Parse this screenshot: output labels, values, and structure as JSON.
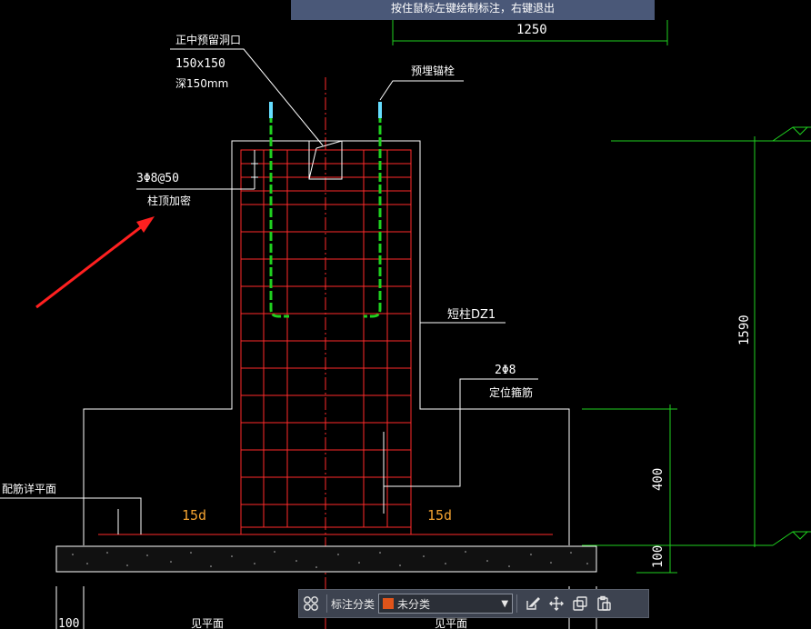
{
  "tip": {
    "text": "按住鼠标左键绘制标注，右键退出"
  },
  "drawing": {
    "dim_top": "1250",
    "dim_right_total": "1590",
    "dim_right_mid": "400",
    "dim_right_low": "100",
    "dim_bottom_left": "100",
    "label_opening_title": "正中预留洞口",
    "label_opening_size": "150x150",
    "label_opening_depth": "深150mm",
    "label_anchor_bolt": "预埋锚栓",
    "label_stirrup_spec": "3Φ8@50",
    "label_stirrup_note": "柱顶加密",
    "label_column": "短柱DZ1",
    "label_position_bar_spec": "2Φ8",
    "label_position_bar_note": "定位箍筋",
    "label_floor": "配筋详平面",
    "label_15d_left": "15d",
    "label_15d_right": "15d",
    "label_bottom_left": "见平面",
    "label_bottom_mid": "见平面"
  },
  "toolbar": {
    "category_label": "标注分类",
    "category_value": "未分类",
    "category_color": "#e0541a"
  },
  "colors": {
    "line_white": "#ffffff",
    "line_red": "#ff2a2a",
    "line_green": "#1fd11f",
    "text_orange": "#f0a030",
    "arrow_red": "#ff2020"
  }
}
